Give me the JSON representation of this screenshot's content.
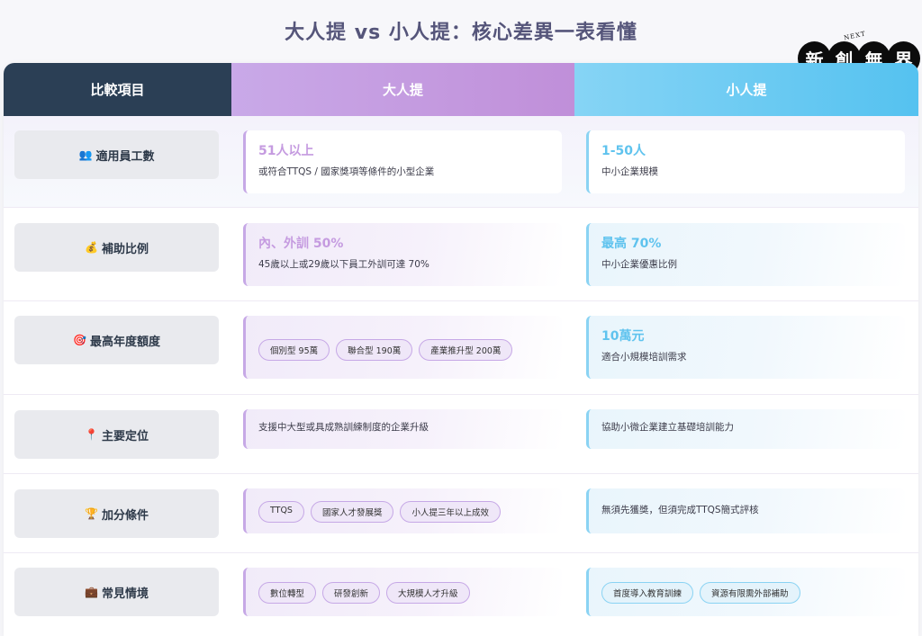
{
  "title": "大人提 vs 小人提：核心差異一表看懂",
  "logo": {
    "sup": "NEXT",
    "chars": [
      "新",
      "創",
      "無",
      "界"
    ]
  },
  "headers": [
    "比較項目",
    "大人提",
    "小人提"
  ],
  "rows": [
    {
      "label": "適用員工數",
      "icon": "👥",
      "big": {
        "h": "51人以上",
        "d": "或符合TTQS / 國家獎項等條件的小型企業"
      },
      "small": {
        "h": "1-50人",
        "d": "中小企業規模"
      }
    },
    {
      "label": "補助比例",
      "icon": "💰",
      "big": {
        "h": "內、外訓 50%",
        "d": "45歲以上或29歲以下員工外訓可達 70%"
      },
      "small": {
        "h": "最高 70%",
        "d": "中小企業優惠比例"
      }
    },
    {
      "label": "最高年度額度",
      "icon": "🎯",
      "big": {
        "tags": [
          "個別型 95萬",
          "聯合型 190萬",
          "產業推升型 200萬"
        ]
      },
      "small": {
        "h": "10萬元",
        "d": "適合小規模培訓需求"
      }
    },
    {
      "label": "主要定位",
      "icon": "📍",
      "big": {
        "d": "支援中大型或具成熟訓練制度的企業升級"
      },
      "small": {
        "d": "協助小微企業建立基礎培訓能力"
      }
    },
    {
      "label": "加分條件",
      "icon": "🏆",
      "big": {
        "tags": [
          "TTQS",
          "國家人才發展獎",
          "小人提三年以上成效"
        ]
      },
      "small": {
        "d": "無須先獲獎，但須完成TTQS簡式評核"
      }
    },
    {
      "label": "常見情境",
      "icon": "💼",
      "big": {
        "tags": [
          "數位轉型",
          "研發創新",
          "大規模人才升級"
        ]
      },
      "small": {
        "tags": [
          "首度導入教育訓練",
          "資源有限需外部補助"
        ]
      }
    }
  ]
}
